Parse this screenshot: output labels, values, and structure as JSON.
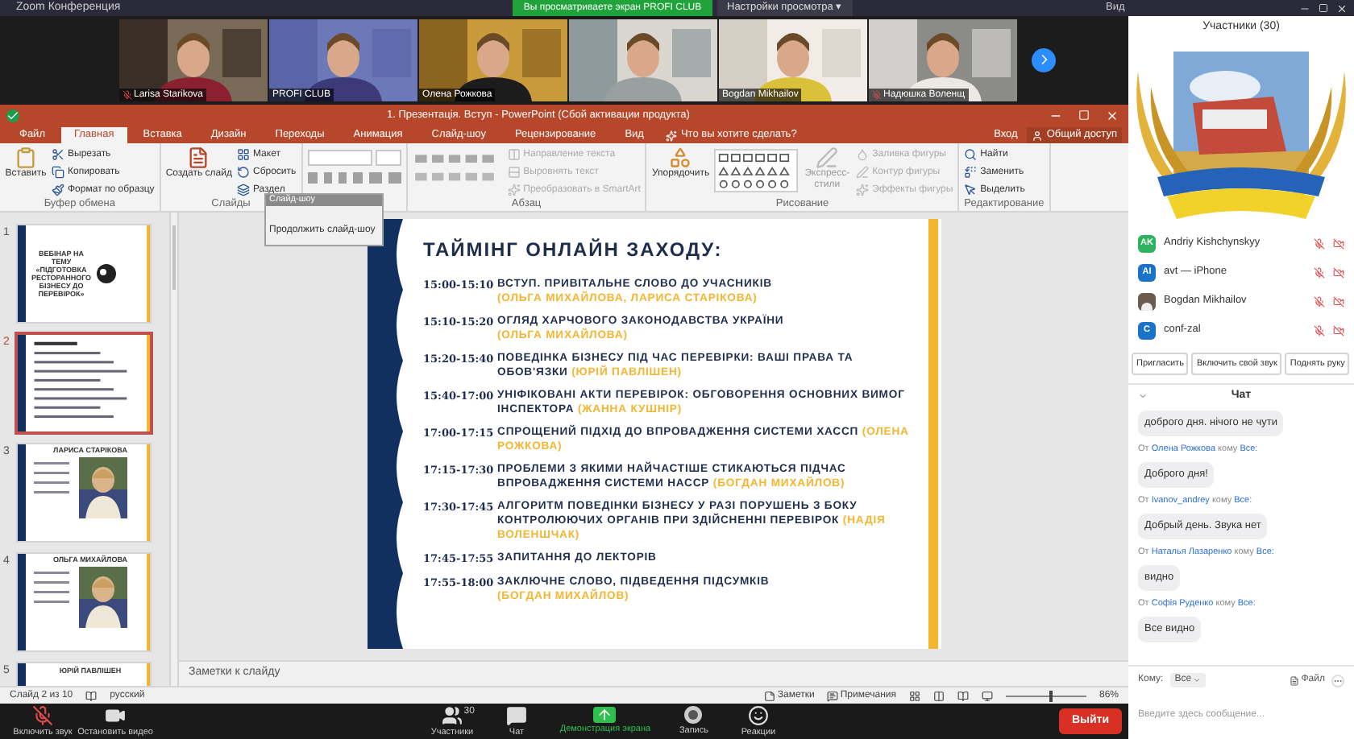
{
  "zoom_title": "Zoom Конференция",
  "share_banner": "Вы просматриваете экран PROFI CLUB",
  "view_options": "Настройки просмотра ▾",
  "view_button": "Вид",
  "videos": [
    {
      "kind": "camera",
      "name": "Larisa Starikova",
      "muted": true
    },
    {
      "kind": "camera",
      "name": "PROFI CLUB",
      "muted": false
    },
    {
      "kind": "camera",
      "name": "Олена Рожкова",
      "muted": false
    },
    {
      "kind": "camera"
    },
    {
      "kind": "camera",
      "name": "Bogdan Mikhailov",
      "muted": false
    },
    {
      "kind": "camera",
      "name": "Надюшка Воленщ",
      "muted": true
    }
  ],
  "ppt": {
    "title": "1. Презентація. Вступ - PowerPoint (Сбой активации продукта)",
    "tabs": [
      {
        "label": "Файл",
        "selected": false
      },
      {
        "label": "Главная",
        "selected": true
      },
      {
        "label": "Вставка",
        "selected": false
      },
      {
        "label": "Дизайн",
        "selected": false
      },
      {
        "label": "Переходы",
        "selected": false
      },
      {
        "label": "Анимация",
        "selected": false
      },
      {
        "label": "Слайд-шоу",
        "selected": false
      },
      {
        "label": "Рецензирование",
        "selected": false
      },
      {
        "label": "Вид",
        "selected": false
      }
    ],
    "tell_me": "Что вы хотите сделать?",
    "sign_in": "Вход",
    "share": "Общий доступ",
    "ribbon": [
      {
        "kind": "clipboard",
        "label": "Буфер обмена",
        "large": "Вставить",
        "small": [
          "Вырезать",
          "Копировать",
          "Формат по образцу"
        ]
      },
      {
        "kind": "slides",
        "label": "Слайды",
        "large": "Создать слайд",
        "small": [
          "Макет",
          "Сбросить",
          "Раздел"
        ]
      },
      {
        "kind": "font"
      },
      {
        "kind": "paragraph",
        "label": "Абзац",
        "small": [
          "Направление текста",
          "Выровнять текст",
          "Преобразовать в SmartArt"
        ]
      },
      {
        "kind": "drawing",
        "label": "Рисование",
        "large": "Упорядочить",
        "large2": "Экспресс-стили",
        "small": [
          "Заливка фигуры",
          "Контур фигуры",
          "Эффекты фигуры"
        ]
      },
      {
        "kind": "editing",
        "label": "Редактирование",
        "small": [
          "Найти",
          "Заменить",
          "Выделить"
        ]
      }
    ],
    "popup": {
      "title": "Слайд-шоу",
      "item": "Продолжить слайд-шоу"
    },
    "thumbnails": [
      {
        "number": "1",
        "kind": "title",
        "text": "ВЕБІНАР НА ТЕМУ «ПІДГОТОВКА РЕСТОРАННОГО БІЗНЕСУ ДО ПЕРЕВІРОК»",
        "selected": false
      },
      {
        "number": "2",
        "kind": "agenda",
        "selected": true
      },
      {
        "number": "3",
        "kind": "person",
        "text": "ЛАРИСА СТАРІКОВА",
        "selected": false
      },
      {
        "number": "4",
        "kind": "person",
        "text": "ОЛЬГА МИХАЙЛОВА",
        "selected": false
      },
      {
        "number": "5",
        "kind": "partial",
        "text": "ЮРІЙ ПАВЛІШЕН",
        "selected": false
      }
    ],
    "slide": {
      "title": "ТАЙМІНГ ОНЛАЙН ЗАХОДУ:",
      "items": [
        {
          "time": "15:00-15:10",
          "text": "ВСТУП. ПРИВІТАЛЬНЕ СЛОВО ДО УЧАСНИКІВ",
          "speaker": "(ОЛЬГА МИХАЙЛОВА, ЛАРИСА СТАРІКОВА)",
          "speaker_newline": true
        },
        {
          "time": "15:10-15:20",
          "text": "ОГЛЯД ХАРЧОВОГО ЗАКОНОДАВСТВА УКРАЇНИ",
          "speaker": "(ОЛЬГА МИХАЙЛОВА)",
          "speaker_newline": true
        },
        {
          "time": "15:20-15:40",
          "text": "ПОВЕДІНКА БІЗНЕСУ ПІД ЧАС ПЕРЕВІРКИ: ВАШІ ПРАВА ТА ОБОВ'ЯЗКИ",
          "speaker": "(ЮРІЙ ПАВЛІШЕН)",
          "speaker_newline": false
        },
        {
          "time": "15:40-17:00",
          "text": "УНІФІКОВАНІ АКТИ ПЕРЕВІРОК: ОБГОВОРЕННЯ ОСНОВНИХ ВИМОГ ІНСПЕКТОРА",
          "speaker": "(ЖАННА КУШНІР)",
          "speaker_newline": false
        },
        {
          "time": "17:00-17:15",
          "text": "СПРОЩЕНИЙ ПІДХІД ДО ВПРОВАДЖЕННЯ СИСТЕМИ ХАССП",
          "speaker": "(ОЛЕНА РОЖКОВА)",
          "speaker_newline": false
        },
        {
          "time": "17:15-17:30",
          "text": "ПРОБЛЕМИ З ЯКИМИ НАЙЧАСТІШЕ СТИКАЮТЬСЯ ПІДЧАС ВПРОВАДЖЕННЯ СИСТЕМИ НАССР",
          "speaker": "(БОГДАН МИХАЙЛОВ)",
          "speaker_newline": false
        },
        {
          "time": "17:30-17:45",
          "text": "АЛГОРИТМ ПОВЕДІНКИ БІЗНЕСУ У РАЗІ ПОРУШЕНЬ З БОКУ КОНТРОЛЮЮЧИХ ОРГАНІВ ПРИ ЗДІЙСНЕННІ ПЕРЕВІРОК",
          "speaker": "(НАДІЯ ВОЛЕНШЧАК)",
          "speaker_newline": false
        },
        {
          "time": "17:45-17:55",
          "text": "ЗАПИТАННЯ ДО ЛЕКТОРІВ"
        },
        {
          "time": "17:55-18:00",
          "text": "ЗАКЛЮЧНЕ СЛОВО, ПІДВЕДЕННЯ ПІДСУМКІВ",
          "speaker": "(БОГДАН МИХАЙЛОВ)",
          "speaker_newline": true
        }
      ]
    },
    "notes_placeholder": "Заметки к слайду",
    "status": {
      "slide": "Слайд 2 из 10",
      "language": "русский",
      "notes": "Заметки",
      "comments": "Примечания",
      "zoom": "86%",
      "level": 0.55
    }
  },
  "participants": {
    "title": "Участники (30)",
    "list": [
      {
        "initials": "AK",
        "name": "Andriy Kishchynskyy",
        "color": "#2db35d",
        "kind": "initials"
      },
      {
        "initials": "AI",
        "name": "avt — iPhone",
        "color": "#1a73c8",
        "kind": "initials"
      },
      {
        "name": "Bogdan Mikhailov",
        "color": "#6b5a50"
      },
      {
        "initials": "C",
        "name": "conf-zal",
        "color": "#1a73c8",
        "kind": "initials"
      }
    ],
    "buttons": [
      "Пригласить",
      "Включить свой звук",
      "Поднять руку"
    ]
  },
  "chat": {
    "title": "Чат",
    "messages": [
      {
        "kind": "bubble",
        "text": "доброго дня. нічого не чути"
      },
      {
        "kind": "header",
        "from_word": "От",
        "from": "Олена Рожкова",
        "to_word": "кому",
        "to": "Все:"
      },
      {
        "kind": "bubble",
        "text": "Доброго дня!"
      },
      {
        "kind": "header",
        "from_word": "От",
        "from": "Ivanov_andrey",
        "to_word": "кому",
        "to": "Все:"
      },
      {
        "kind": "bubble",
        "text": "Добрый день. Звука нет"
      },
      {
        "kind": "header",
        "from_word": "От",
        "from": "Наталья Лазаренко",
        "to_word": "кому",
        "to": "Все:"
      },
      {
        "kind": "bubble",
        "text": "видно"
      },
      {
        "kind": "header",
        "from_word": "От",
        "from": "Софія Руденко",
        "to_word": "кому",
        "to": "Все:"
      },
      {
        "kind": "bubble",
        "text": "Все видно"
      }
    ],
    "to_label": "Кому:",
    "to_value": "Все",
    "file": "Файл",
    "placeholder": "Введите здесь сообщение..."
  },
  "toolbar": {
    "items": [
      {
        "kind": "mic",
        "label": "Включить звук"
      },
      {
        "kind": "video",
        "label": "Остановить видео"
      },
      {
        "kind": "participants",
        "label": "Участники",
        "count": "30"
      },
      {
        "kind": "chat",
        "label": "Чат"
      },
      {
        "kind": "share",
        "label": "Демонстрация экрана"
      },
      {
        "kind": "record",
        "label": "Запись"
      },
      {
        "kind": "reactions",
        "label": "Реакции"
      }
    ],
    "leave": "Выйти"
  }
}
